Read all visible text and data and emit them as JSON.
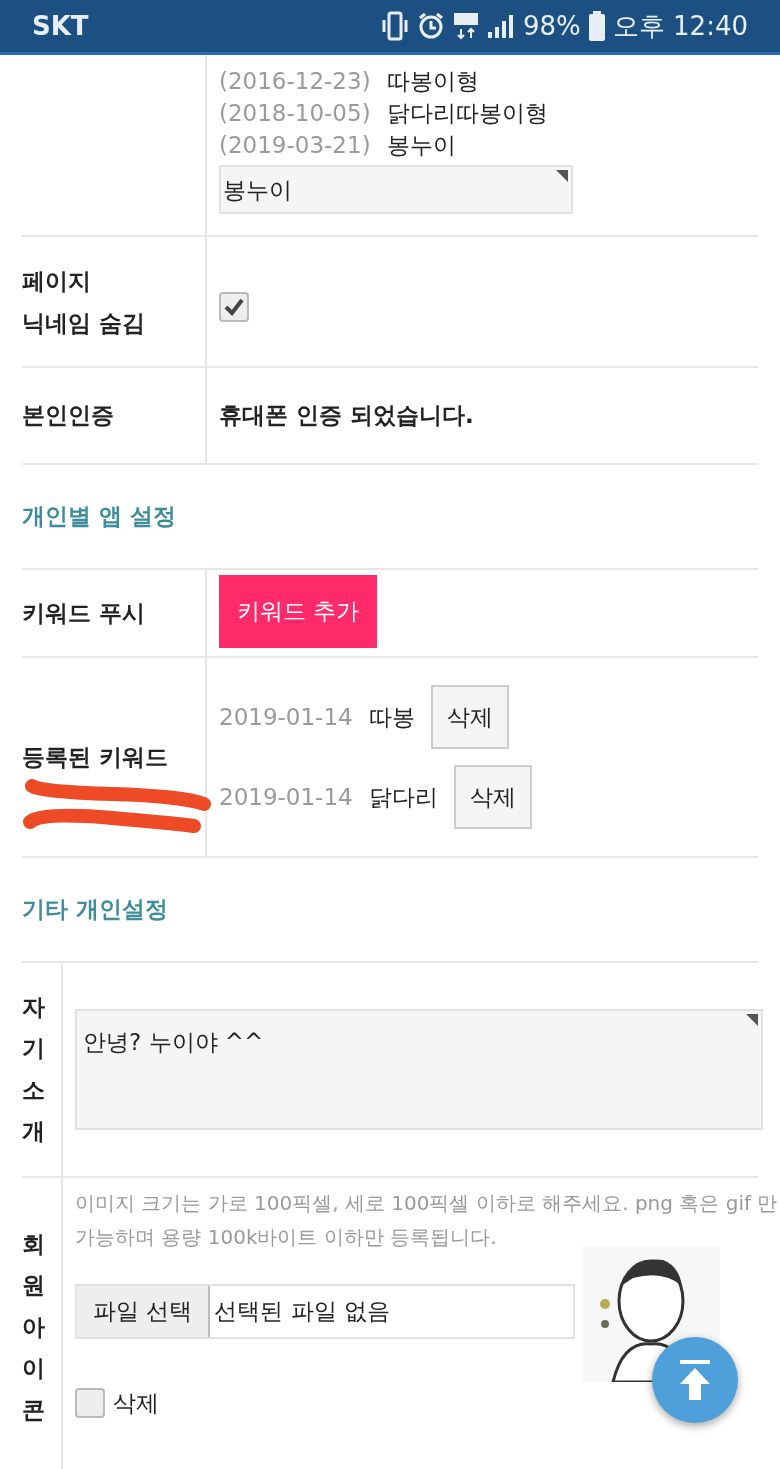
{
  "status_bar": {
    "carrier": "SKT",
    "battery": "98%",
    "time": "오후 12:40"
  },
  "nickname_history": {
    "entries": [
      {
        "date": "(2016-12-23)",
        "name": "따봉이형"
      },
      {
        "date": "(2018-10-05)",
        "name": "닭다리따봉이형"
      },
      {
        "date": "(2019-03-21)",
        "name": "봉누이"
      }
    ],
    "value": "봉누이"
  },
  "hide_nickname": {
    "label": [
      "페이지",
      "닉네임 숨김"
    ],
    "checked": true
  },
  "verification": {
    "label": "본인인증",
    "text": "휴대폰 인증 되었습니다."
  },
  "app_settings": {
    "heading": "개인별 앱 설정",
    "push_label": "키워드 푸시",
    "add_button": "키워드 추가",
    "keywords_label": "등록된 키워드",
    "keywords": [
      {
        "date": "2019-01-14",
        "word": "따봉",
        "delete": "삭제"
      },
      {
        "date": "2019-01-14",
        "word": "닭다리",
        "delete": "삭제"
      }
    ]
  },
  "other_settings": {
    "heading": "기타 개인설정",
    "intro_label": "자기소개",
    "intro_value": "안녕? 누이야 ^^",
    "icon_label": "회원아이콘",
    "icon_help": "이미지 크기는 가로 100픽셀, 세로 100픽셀 이하로 해주세요. png 혹은 gif 만 가능하며 용량 100k바이트 이하만 등록됩니다.",
    "file_button": "파일 선택",
    "file_status": "선택된 파일 없음",
    "delete_label": "삭제",
    "delete_checked": false
  }
}
